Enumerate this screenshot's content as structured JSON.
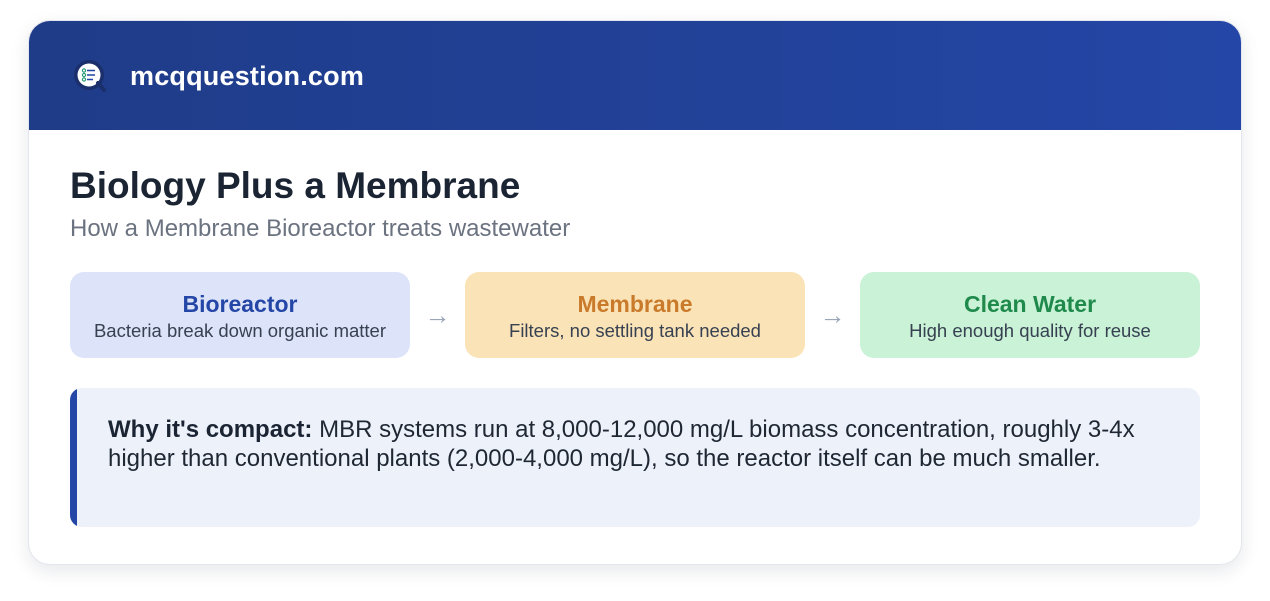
{
  "header": {
    "brand": "mcqquestion.com",
    "logo_icon": "quiz-checklist-icon",
    "colors": {
      "start": "#1f3c88",
      "end": "#2446a6"
    }
  },
  "main": {
    "title": "Biology Plus a Membrane",
    "subtitle": "How a Membrane Bioreactor treats wastewater"
  },
  "steps": [
    {
      "title": "Bioreactor",
      "desc": "Bacteria break down organic matter",
      "accent": "#2446a6",
      "bg": "#dde4fa"
    },
    {
      "title": "Membrane",
      "desc": "Filters, no settling tank needed",
      "accent": "#c97a2a",
      "bg": "#fbe3b8"
    },
    {
      "title": "Clean Water",
      "desc": "High enough quality for reuse",
      "accent": "#1f8a4c",
      "bg": "#c9f2d6"
    }
  ],
  "arrows": [
    "→",
    "→"
  ],
  "note": {
    "label": "Why it's compact:",
    "text": " MBR systems run at 8,000-12,000 mg/L biomass concentration, roughly 3-4x higher than conventional plants (2,000-4,000 mg/L), so the reactor itself can be much smaller.",
    "accent": "#2446a6"
  }
}
